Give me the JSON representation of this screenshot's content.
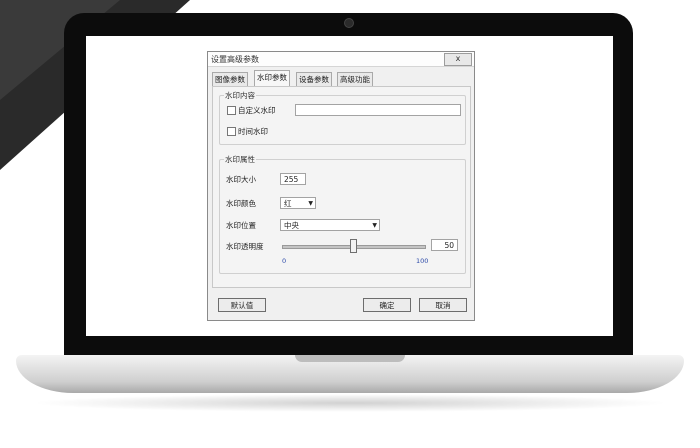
{
  "dialog": {
    "title": "设置高级参数",
    "close_label": "x",
    "tabs": [
      {
        "label": "图像参数"
      },
      {
        "label": "水印参数"
      },
      {
        "label": "设备参数"
      },
      {
        "label": "高级功能"
      }
    ],
    "content_group": {
      "title": "水印内容",
      "custom_watermark_label": "自定义水印",
      "custom_watermark_value": "",
      "time_watermark_label": "时间水印"
    },
    "attributes_group": {
      "title": "水印属性",
      "size_label": "水印大小",
      "size_value": "255",
      "color_label": "水印颜色",
      "color_value": "红",
      "position_label": "水印位置",
      "position_value": "中央",
      "transparency_label": "水印透明度",
      "transparency_value": "50",
      "transparency_level": 50,
      "transparency_min": "0",
      "transparency_max": "100"
    },
    "buttons": {
      "default": "默认值",
      "ok": "确定",
      "cancel": "取消"
    }
  },
  "colors": {
    "lid": "#0c0c0c",
    "wedge": "#2a2a2a",
    "dialog_bg": "#f0f0f0"
  }
}
